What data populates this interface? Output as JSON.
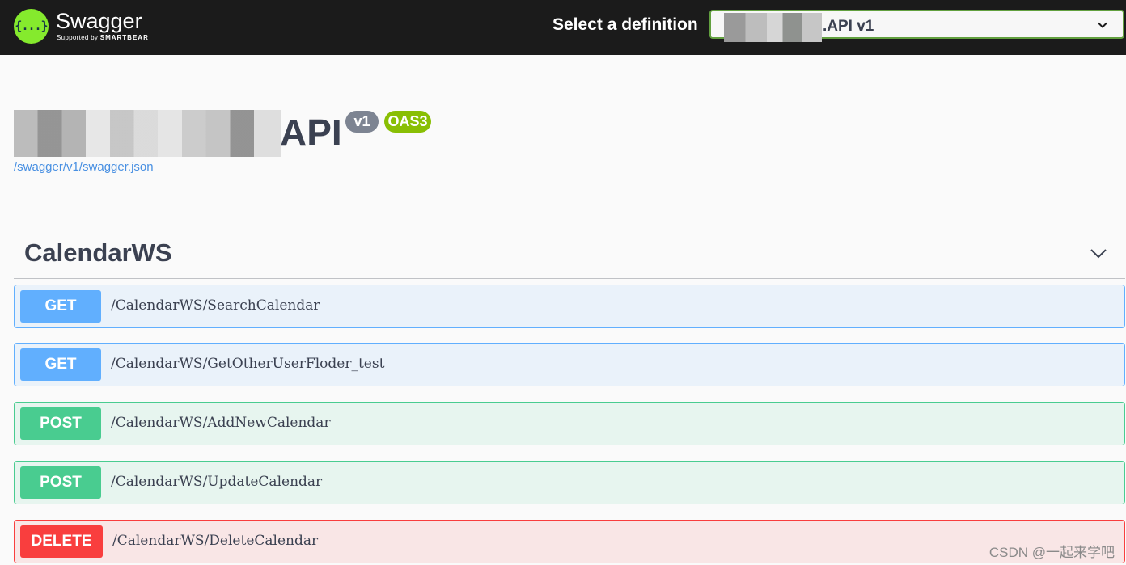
{
  "topbar": {
    "brand_name": "Swagger",
    "brand_glyph": "{...}",
    "brand_sub_prefix": "Supported by",
    "brand_sub_company": "SMARTBEAR",
    "select_label": "Select a definition",
    "selected_definition": ".API v1",
    "colors": {
      "background": "#1b1b1b",
      "logo": "#85ea2d",
      "select_border": "#62a03f"
    }
  },
  "info": {
    "title_suffix": "API",
    "version_badge": "v1",
    "oas_badge": "OAS3",
    "spec_link": "/swagger/v1/swagger.json"
  },
  "section": {
    "title": "CalendarWS",
    "icon": "chevron-down-icon"
  },
  "operations": [
    {
      "method": "GET",
      "path": "/CalendarWS/SearchCalendar"
    },
    {
      "method": "GET",
      "path": "/CalendarWS/GetOtherUserFloder_test"
    },
    {
      "method": "POST",
      "path": "/CalendarWS/AddNewCalendar"
    },
    {
      "method": "POST",
      "path": "/CalendarWS/UpdateCalendar"
    },
    {
      "method": "DELETE",
      "path": "/CalendarWS/DeleteCalendar"
    }
  ],
  "method_colors": {
    "GET": "#61affe",
    "POST": "#49cc90",
    "DELETE": "#f93e3e"
  },
  "watermark": "CSDN @一起来学吧"
}
